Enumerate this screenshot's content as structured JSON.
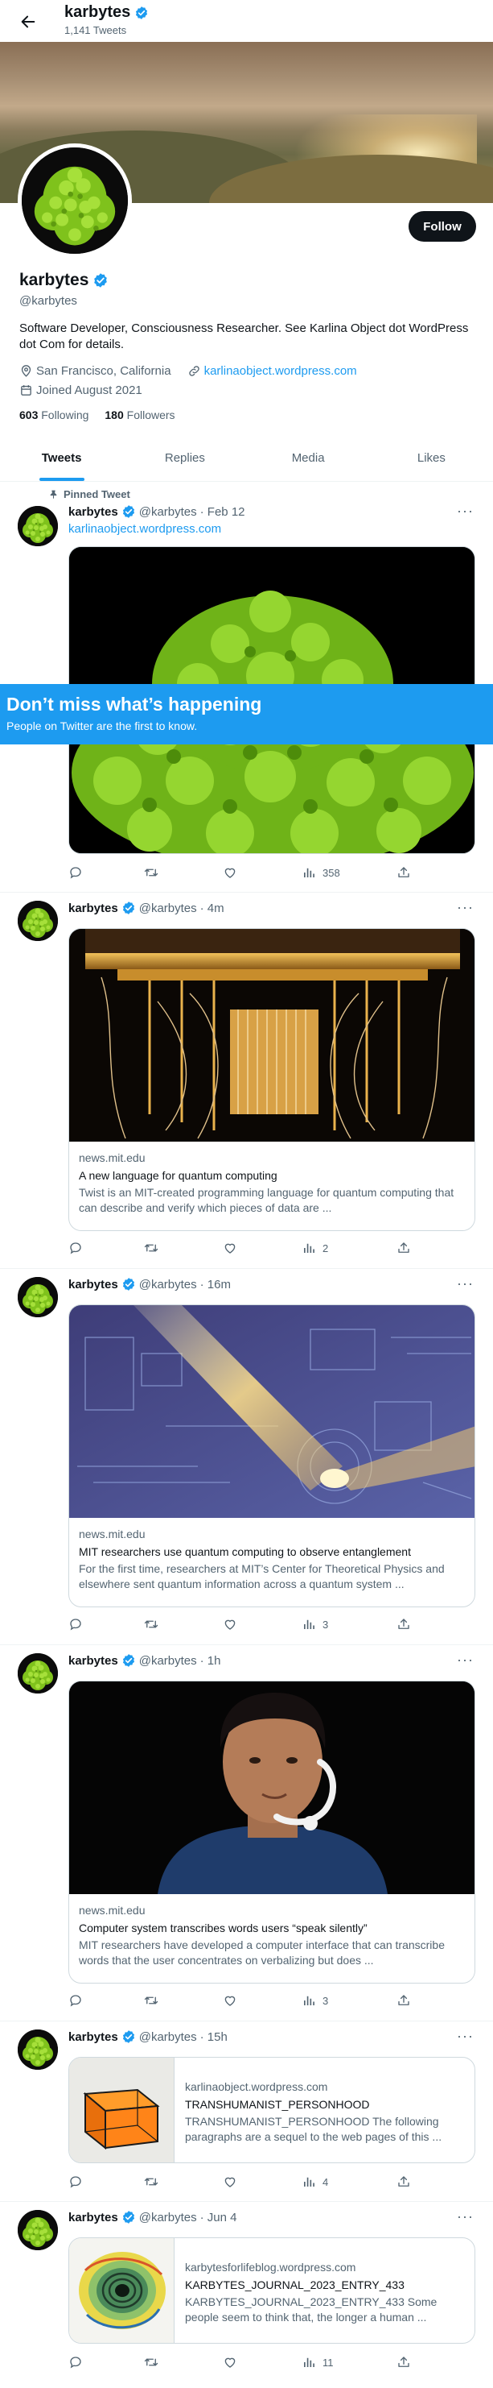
{
  "colors": {
    "accent": "#1d9bf0",
    "text": "#0f1419",
    "muted": "#536471",
    "border": "#cfd9de"
  },
  "header": {
    "title": "karbytes",
    "subtitle": "1,141 Tweets",
    "back_icon": "arrow-left-icon"
  },
  "profile": {
    "name": "karbytes",
    "handle": "@karbytes",
    "follow_label": "Follow",
    "bio": "Software Developer, Consciousness Researcher. See Karlina Object dot WordPress dot Com for details.",
    "location": "San Francisco, California",
    "website": "karlinaobject.wordpress.com",
    "joined": "Joined August 2021",
    "following_count": "603",
    "following_label": "Following",
    "followers_count": "180",
    "followers_label": "Followers"
  },
  "tabs": [
    {
      "label": "Tweets",
      "active": true
    },
    {
      "label": "Replies",
      "active": false
    },
    {
      "label": "Media",
      "active": false
    },
    {
      "label": "Likes",
      "active": false
    }
  ],
  "promo": {
    "title": "Don’t miss what’s happening",
    "subtitle": "People on Twitter are the first to know."
  },
  "tweets": [
    {
      "pinned_label": "Pinned Tweet",
      "name": "karbytes",
      "handle": "@karbytes",
      "time": "· Feb 12",
      "link": "karlinaobject.wordpress.com",
      "views": "358"
    },
    {
      "name": "karbytes",
      "handle": "@karbytes",
      "time": "· 4m",
      "card": {
        "domain": "news.mit.edu",
        "title": "A new language for quantum computing",
        "desc": "Twist is an MIT-created programming language for quantum computing that can describe and verify which pieces of data are ..."
      },
      "views": "2"
    },
    {
      "name": "karbytes",
      "handle": "@karbytes",
      "time": "· 16m",
      "card": {
        "domain": "news.mit.edu",
        "title": "MIT researchers use quantum computing to observe entanglement",
        "desc": "For the first time, researchers at MIT’s Center for Theoretical Physics and elsewhere sent quantum information across a quantum system ..."
      },
      "views": "3"
    },
    {
      "name": "karbytes",
      "handle": "@karbytes",
      "time": "· 1h",
      "card": {
        "domain": "news.mit.edu",
        "title": "Computer system transcribes words users “speak silently”",
        "desc": "MIT researchers have developed a computer interface that can transcribe words that the user concentrates on verbalizing but does ..."
      },
      "views": "3"
    },
    {
      "name": "karbytes",
      "handle": "@karbytes",
      "time": "· 15h",
      "card": {
        "domain": "karlinaobject.wordpress.com",
        "title": "TRANSHUMANIST_PERSONHOOD",
        "desc": "TRANSHUMANIST_PERSONHOOD The following paragraphs are a sequel to the web pages of this ..."
      },
      "views": "4"
    },
    {
      "name": "karbytes",
      "handle": "@karbytes",
      "time": "· Jun 4",
      "card": {
        "domain": "karbytesforlifeblog.wordpress.com",
        "title": "KARBYTES_JOURNAL_2023_ENTRY_433",
        "desc": "KARBYTES_JOURNAL_2023_ENTRY_433 Some people seem to think that, the longer a human ..."
      },
      "views": "11"
    }
  ]
}
